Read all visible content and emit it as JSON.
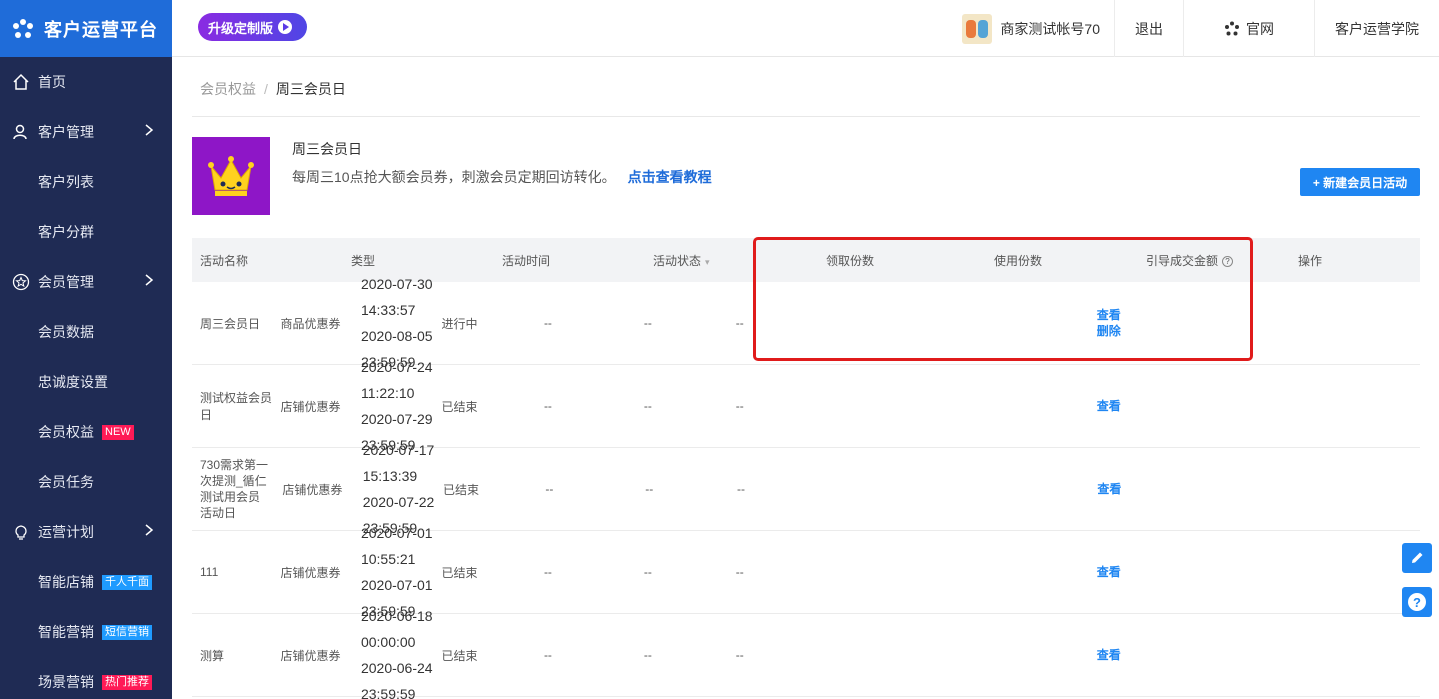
{
  "brand": {
    "title": "客户运营平台"
  },
  "colors": {
    "sidebar": "#1f2b54",
    "brand": "#1f6cd9",
    "accent": "#1f86f2",
    "highlight": "#e01b1b"
  },
  "sidebar": {
    "items": [
      {
        "label": "首页",
        "icon": "home-icon"
      },
      {
        "label": "客户管理",
        "icon": "user-icon"
      },
      {
        "label": "客户列表"
      },
      {
        "label": "客户分群"
      },
      {
        "label": "会员管理",
        "icon": "star-icon"
      },
      {
        "label": "会员数据"
      },
      {
        "label": "忠诚度设置"
      },
      {
        "label": "会员权益",
        "tag": "NEW"
      },
      {
        "label": "会员任务"
      },
      {
        "label": "运营计划",
        "icon": "bulb-icon"
      },
      {
        "label": "智能店铺",
        "tag": "千人千面"
      },
      {
        "label": "智能营销",
        "tag": "短信营销"
      },
      {
        "label": "场景营销",
        "tag": "热门推荐"
      }
    ]
  },
  "header": {
    "upgrade": "升级定制版",
    "account": "商家测试帐号70",
    "logout": "退出",
    "official": "官网",
    "academy": "客户运营学院"
  },
  "breadcrumb": {
    "parent": "会员权益",
    "separator": "/",
    "current": "周三会员日"
  },
  "info": {
    "title": "周三会员日",
    "desc": "每周三10点抢大额会员券，刺激会员定期回访转化。",
    "link": "点击查看教程"
  },
  "new_button": "+ 新建会员日活动",
  "table": {
    "headers": [
      "活动名称",
      "类型",
      "活动时间",
      "活动状态",
      "领取份数",
      "使用份数",
      "引导成交金额",
      "操作"
    ],
    "rows": [
      {
        "name": "周三会员日",
        "type": "商品优惠券",
        "start": "2020-07-30 14:33:57",
        "end": "2020-08-05 23:59:59",
        "status": "进行中",
        "claimed": "--",
        "used": "--",
        "amount": "--",
        "ops": [
          "查看",
          "删除"
        ]
      },
      {
        "name": "测试权益会员日",
        "type": "店铺优惠券",
        "start": "2020-07-24 11:22:10",
        "end": "2020-07-29 23:59:59",
        "status": "已结束",
        "claimed": "--",
        "used": "--",
        "amount": "--",
        "ops": [
          "查看"
        ]
      },
      {
        "name": "730需求第一次提测_循仁测试用会员活动日",
        "type": "店铺优惠券",
        "start": "2020-07-17 15:13:39",
        "end": "2020-07-22 23:59:59",
        "status": "已结束",
        "claimed": "--",
        "used": "--",
        "amount": "--",
        "ops": [
          "查看"
        ]
      },
      {
        "name": "111",
        "type": "店铺优惠券",
        "start": "2020-07-01 10:55:21",
        "end": "2020-07-01 23:59:59",
        "status": "已结束",
        "claimed": "--",
        "used": "--",
        "amount": "--",
        "ops": [
          "查看"
        ]
      },
      {
        "name": "测算",
        "type": "店铺优惠券",
        "start": "2020-06-18 00:00:00",
        "end": "2020-06-24 23:59:59",
        "status": "已结束",
        "claimed": "--",
        "used": "--",
        "amount": "--",
        "ops": [
          "查看"
        ]
      }
    ]
  },
  "float": {
    "edit": "edit-icon",
    "help": "?"
  }
}
